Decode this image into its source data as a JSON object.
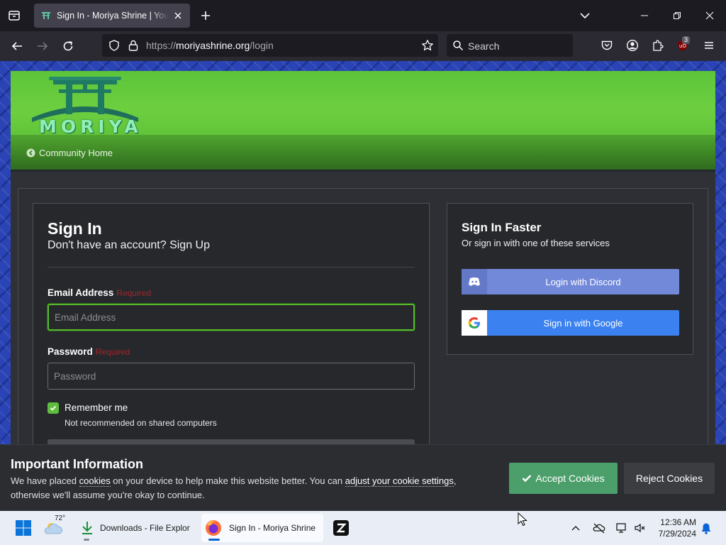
{
  "browser": {
    "tab_title": "Sign In - Moriya Shrine | Your re",
    "url_prefix": "https://",
    "url_domain": "moriyashrine.org",
    "url_path": "/login",
    "search_placeholder": "Search",
    "extension_badge": "3"
  },
  "site": {
    "logo_text": "MORIYA",
    "breadcrumb": "Community Home"
  },
  "signin": {
    "title": "Sign In",
    "subtitle": "Don't have an account? Sign Up",
    "email_label": "Email Address",
    "email_required": "Required",
    "email_placeholder": "Email Address",
    "password_label": "Password",
    "password_required": "Required",
    "password_placeholder": "Password",
    "remember_label": "Remember me",
    "remember_hint": "Not recommended on shared computers"
  },
  "faster": {
    "title": "Sign In Faster",
    "subtitle": "Or sign in with one of these services",
    "discord_label": "Login with Discord",
    "google_label": "Sign in with Google"
  },
  "cookie": {
    "title": "Important Information",
    "text_1": "We have placed ",
    "link_cookies": "cookies",
    "text_2": " on your device to help make this website better. You can ",
    "link_settings": "adjust your cookie settings",
    "text_3": ", otherwise we'll assume you're okay to continue.",
    "accept_label": "Accept Cookies",
    "reject_label": "Reject Cookies"
  },
  "taskbar": {
    "weather_temp": "72°",
    "file_explorer_label": "Downloads - File Explor",
    "firefox_label": "Sign In - Moriya Shrine",
    "time": "12:36 AM",
    "date": "7/29/2024"
  },
  "colors": {
    "header_green": "#6dcf3f",
    "accept_green": "#4c9f6a",
    "discord": "#7289da",
    "google": "#3b82f0",
    "page_blue": "#2a44b5"
  }
}
